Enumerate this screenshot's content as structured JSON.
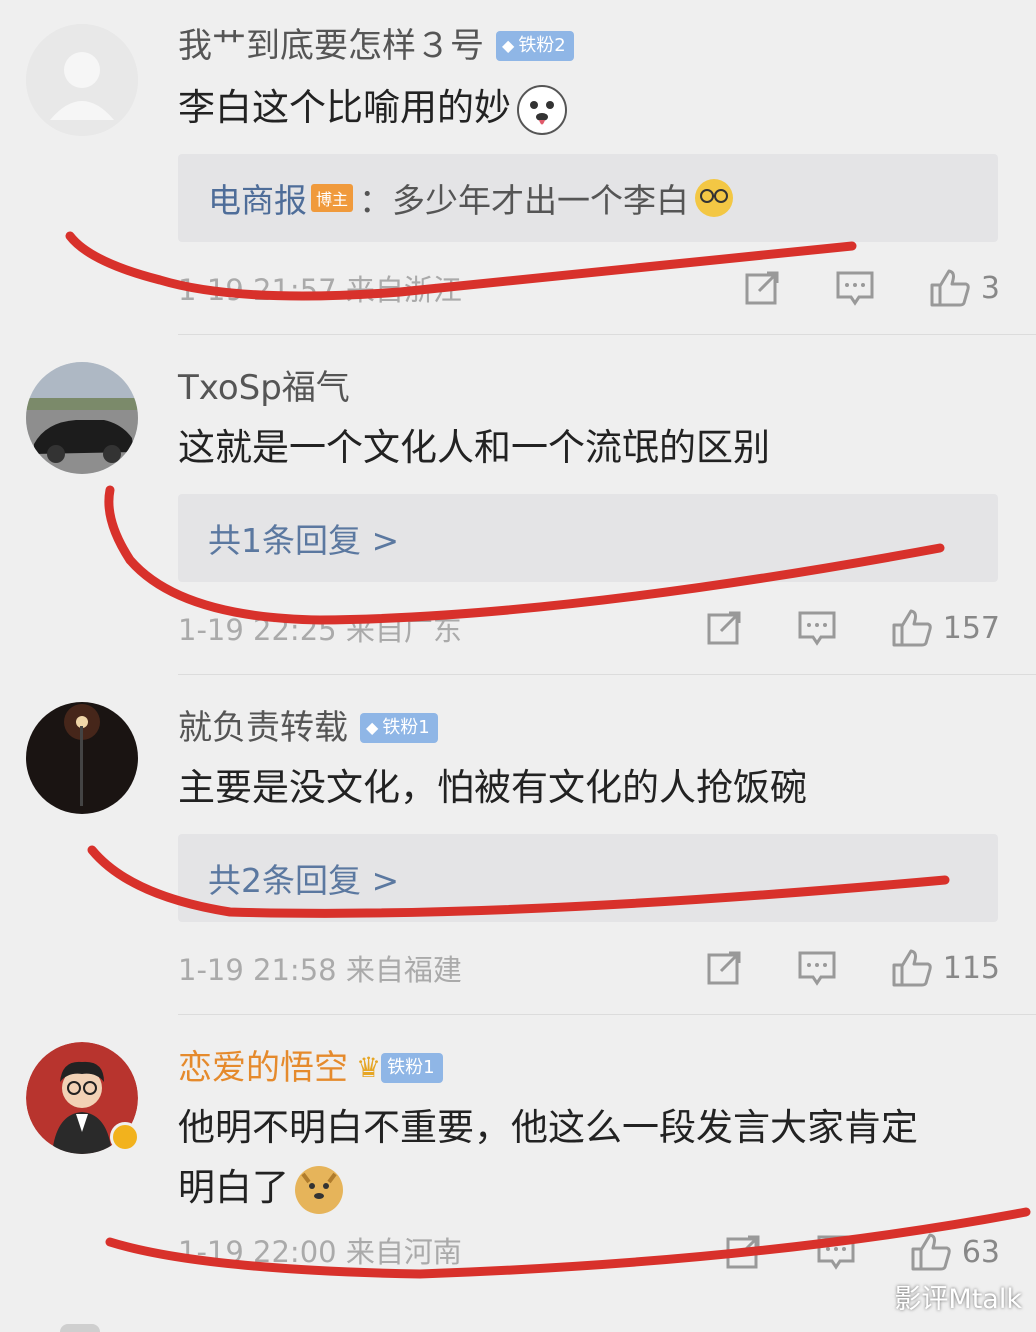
{
  "comments": [
    {
      "username": "我艹到底要怎样３号",
      "badge": "铁粉2",
      "text": "李白这个比喻用的妙",
      "emoji": "husky-emoji",
      "reply": {
        "name": "电商报",
        "tag": "博主",
        "separator": "：",
        "text": "多少年才出一个李白",
        "emoji": "glasses-emoji"
      },
      "meta": "1-19 21:57 来自浙江",
      "likes": "3"
    },
    {
      "username": "TxoSp福气",
      "text": "这就是一个文化人和一个流氓的区别",
      "reply_link": "共1条回复 >",
      "meta": "1-19 22:25 来自广东",
      "likes": "157"
    },
    {
      "username": "就负责转载",
      "badge": "铁粉1",
      "text": "主要是没文化，怕被有文化的人抢饭碗",
      "reply_link": "共2条回复 >",
      "meta": "1-19 21:58 来自福建",
      "likes": "115"
    },
    {
      "username": "恋爱的悟空",
      "badge": "铁粉1",
      "text_line1": "他明不明白不重要，他这么一段发言大家肯定",
      "text_line2": "明白了",
      "emoji": "doge-emoji",
      "meta": "1-19 22:00 来自河南",
      "likes": "63"
    }
  ],
  "watermark": "影评Mtalk",
  "colors": {
    "background": "#efefef",
    "strike_red": "#d8312b",
    "badge_blue": "#8fb6e6",
    "username_orange": "#e58a2c"
  }
}
